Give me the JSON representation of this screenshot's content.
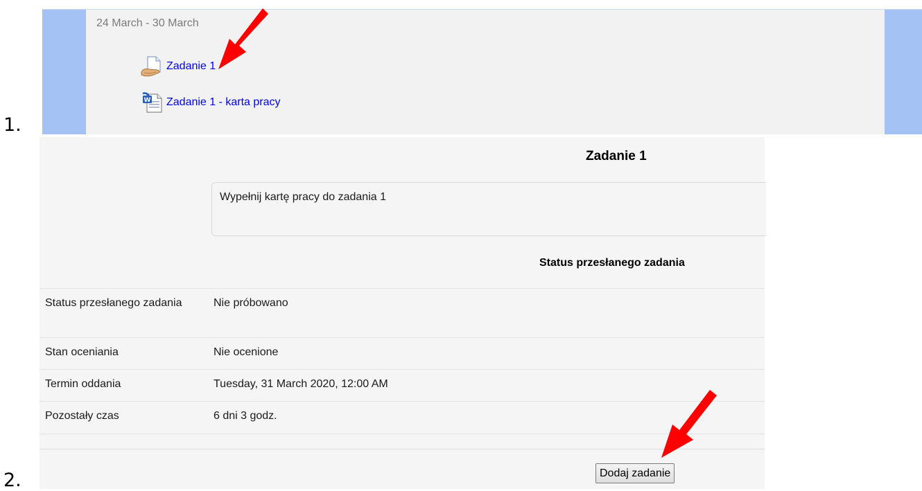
{
  "steps": [
    "1.",
    "2."
  ],
  "course_section": {
    "week_title": "24 March - 30 March",
    "activities": [
      {
        "icon": "assignment-icon",
        "label": "Zadanie 1"
      },
      {
        "icon": "word-document-icon",
        "label": "Zadanie 1 - karta pracy"
      }
    ],
    "colors": {
      "side_band": "#a4c2f4",
      "content_bg": "#f2f2f2",
      "link": "#0000ee"
    }
  },
  "assignment": {
    "title": "Zadanie 1",
    "description": "Wypełnij kartę pracy do zadania 1",
    "status_heading": "Status przesłanego zadania",
    "status_rows": [
      {
        "label": "Status przesłanego zadania",
        "value": "Nie próbowano"
      },
      {
        "label": "Stan oceniania",
        "value": "Nie ocenione"
      },
      {
        "label": "Termin oddania",
        "value": "Tuesday, 31 March 2020, 12:00 AM"
      },
      {
        "label": "Pozostały czas",
        "value": "6 dni 3 godz."
      }
    ],
    "add_button_label": "Dodaj zadanie"
  },
  "annotations": {
    "arrow_color": "#ff0000",
    "arrows": [
      "arrow-pointing-to-assignment-link",
      "arrow-pointing-to-add-button"
    ]
  }
}
